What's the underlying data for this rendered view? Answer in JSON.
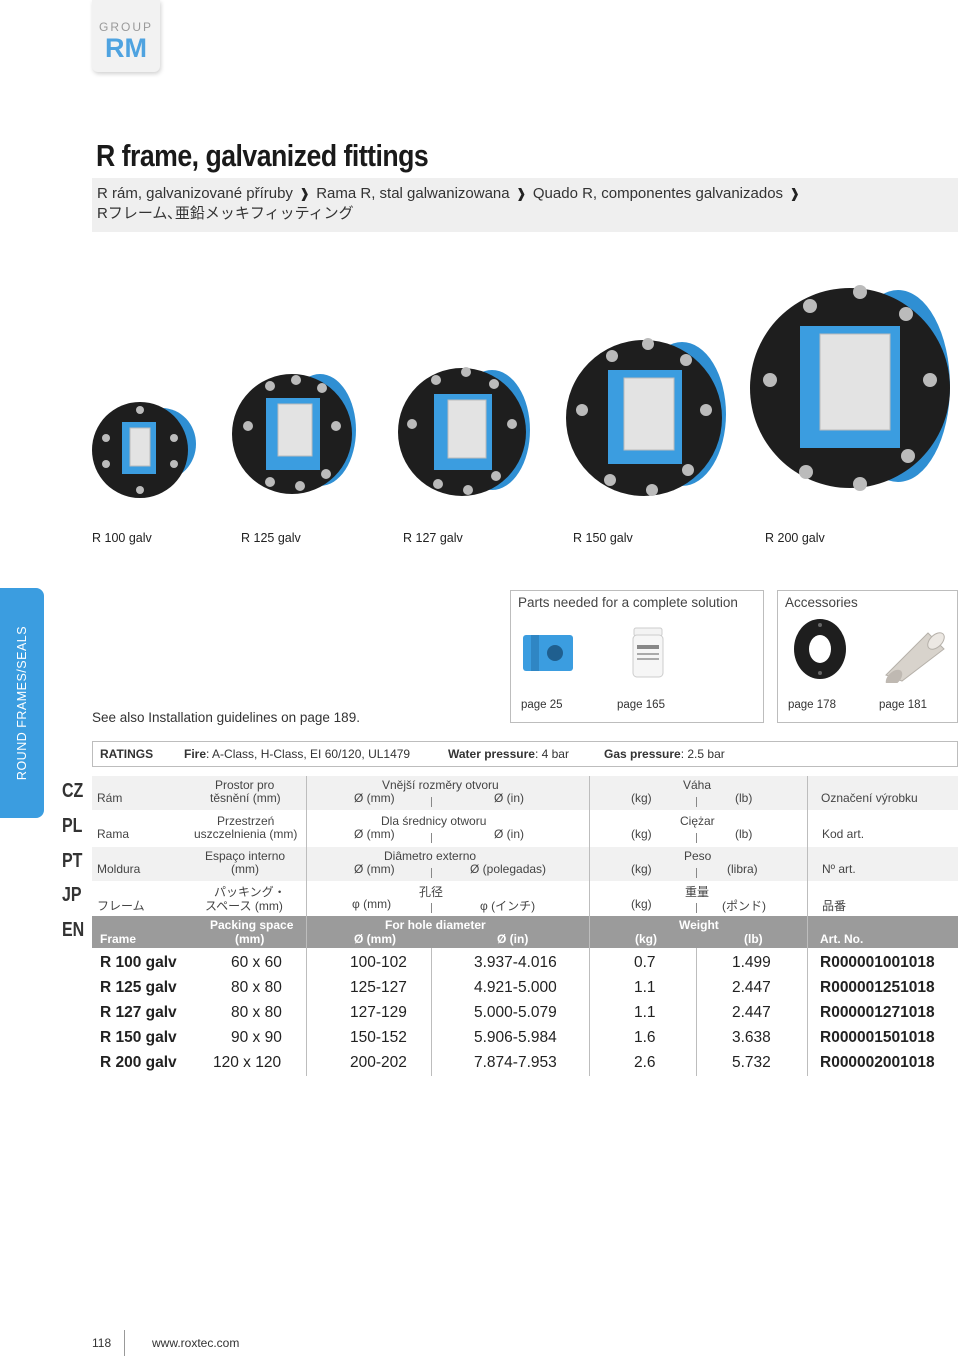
{
  "group": {
    "label": "GROUP",
    "code": "RM"
  },
  "title": "R frame, galvanized fittings",
  "subtitle": {
    "line1_parts": [
      "R rám, galvanizované příruby",
      "Rama R, stal galwanizowana",
      "Quado R, componentes galvanizados"
    ],
    "separator": "❱",
    "line2": "Rフレーム､亜鉛メッキフィッティング"
  },
  "products": [
    "R 100 galv",
    "R 125 galv",
    "R 127 galv",
    "R 150 galv",
    "R 200 galv"
  ],
  "side_tab": "ROUND FRAMES/SEALS",
  "lang_codes": [
    "CZ",
    "PL",
    "PT",
    "JP",
    "EN"
  ],
  "parts": {
    "title": "Parts needed for a complete solution",
    "pages": [
      "page 25",
      "page 165"
    ]
  },
  "accessories": {
    "title": "Accessories",
    "pages": [
      "page 178",
      "page 181"
    ]
  },
  "see_also": "See also Installation guidelines on page 189.",
  "ratings": {
    "label": "RATINGS",
    "fire_label": "Fire",
    "fire_value": ": A-Class, H-Class, EI 60/120, UL1479",
    "water_label": "Water pressure",
    "water_value": ": 4 bar",
    "gas_label": "Gas pressure",
    "gas_value": ": 2.5 bar"
  },
  "header_rows": [
    {
      "lang": "cz",
      "frame": "Rám",
      "space1": "Prostor pro",
      "space2": "těsnění (mm)",
      "hole": "Vnější rozměry otvoru",
      "mm": "Ø (mm)",
      "in": "Ø (in)",
      "weight": "Váha",
      "kg": "(kg)",
      "lb": "(lb)",
      "art": "Označení výrobku"
    },
    {
      "lang": "pl",
      "frame": "Rama",
      "space1": "Przestrzeń",
      "space2": "uszczelnienia (mm)",
      "hole": "Dla średnicy otworu",
      "mm": "Ø (mm)",
      "in": "Ø (in)",
      "weight": "Ciężar",
      "kg": "(kg)",
      "lb": "(lb)",
      "art": "Kod art."
    },
    {
      "lang": "pt",
      "frame": "Moldura",
      "space1": "Espaço interno",
      "space2": "(mm)",
      "hole": "Diâmetro externo",
      "mm": "Ø (mm)",
      "in": "Ø (polegadas)",
      "weight": "Peso",
      "kg": "(kg)",
      "lb": "(libra)",
      "art": "Nº art."
    },
    {
      "lang": "jp",
      "frame": "フレーム",
      "space1": "パッキング・",
      "space2": "スペース (mm)",
      "hole": "孔径",
      "mm": "φ (mm)",
      "in": "φ (インチ)",
      "weight": "重量",
      "kg": "(kg)",
      "lb": "(ポンド)",
      "art": "品番"
    },
    {
      "lang": "en",
      "frame": "Frame",
      "space1": "Packing space",
      "space2": "(mm)",
      "hole": "For hole diameter",
      "mm": "Ø (mm)",
      "in": "Ø (in)",
      "weight": "Weight",
      "kg": "(kg)",
      "lb": "(lb)",
      "art": "Art. No."
    }
  ],
  "rows": [
    {
      "frame": "R 100 galv",
      "space": "60 x 60",
      "mm": "100-102",
      "in": "3.937-4.016",
      "kg": "0.7",
      "lb": "1.499",
      "art": "R000001001018"
    },
    {
      "frame": "R 125 galv",
      "space": "80 x 80",
      "mm": "125-127",
      "in": "4.921-5.000",
      "kg": "1.1",
      "lb": "2.447",
      "art": "R000001251018"
    },
    {
      "frame": "R 127 galv",
      "space": "80 x 80",
      "mm": "127-129",
      "in": "5.000-5.079",
      "kg": "1.1",
      "lb": "2.447",
      "art": "R000001271018"
    },
    {
      "frame": "R 150 galv",
      "space": "90 x 90",
      "mm": "150-152",
      "in": "5.906-5.984",
      "kg": "1.6",
      "lb": "3.638",
      "art": "R000001501018"
    },
    {
      "frame": "R 200 galv",
      "space": "120 x 120",
      "mm": "200-202",
      "in": "7.874-7.953",
      "kg": "2.6",
      "lb": "5.732",
      "art": "R000002001018"
    }
  ],
  "footer": {
    "page": "118",
    "url": "www.roxtec.com"
  },
  "colors": {
    "accent": "#3b9de0",
    "group_code": "#4fa3e0",
    "en_header": "#9b9b9b"
  }
}
